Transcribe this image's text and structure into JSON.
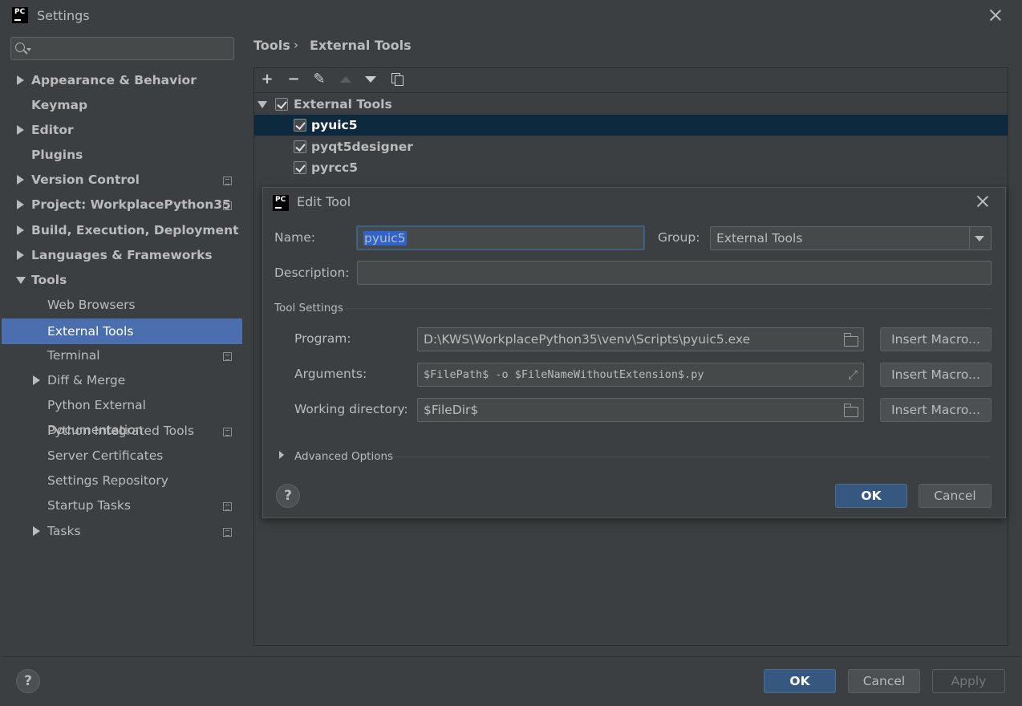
{
  "window": {
    "title": "Settings"
  },
  "search": {
    "placeholder": ""
  },
  "sidebar": {
    "items": [
      {
        "label": "Appearance & Behavior"
      },
      {
        "label": "Keymap"
      },
      {
        "label": "Editor"
      },
      {
        "label": "Plugins"
      },
      {
        "label": "Version Control"
      },
      {
        "label": "Project: WorkplacePython35"
      },
      {
        "label": "Build, Execution, Deployment"
      },
      {
        "label": "Languages & Frameworks"
      },
      {
        "label": "Tools"
      },
      {
        "label": "Web Browsers"
      },
      {
        "label": "External Tools"
      },
      {
        "label": "Terminal"
      },
      {
        "label": "Diff & Merge"
      },
      {
        "label": "Python External Documentation"
      },
      {
        "label": "Python Integrated Tools"
      },
      {
        "label": "Server Certificates"
      },
      {
        "label": "Settings Repository"
      },
      {
        "label": "Startup Tasks"
      },
      {
        "label": "Tasks"
      }
    ]
  },
  "breadcrumb": {
    "parent": "Tools",
    "separator": "›",
    "current": "External Tools"
  },
  "tree": {
    "group": "External Tools",
    "items": [
      {
        "label": "pyuic5"
      },
      {
        "label": "pyqt5designer"
      },
      {
        "label": "pyrcc5"
      }
    ]
  },
  "dialog": {
    "title": "Edit Tool",
    "name_label": "Name:",
    "name_value": "pyuic5",
    "group_label": "Group:",
    "group_value": "External Tools",
    "description_label": "Description:",
    "description_value": "",
    "tool_settings_label": "Tool Settings",
    "program_label": "Program:",
    "program_value": "D:\\KWS\\WorkplacePython35\\venv\\Scripts\\pyuic5.exe",
    "arguments_label": "Arguments:",
    "arguments_value": "$FilePath$ -o $FileNameWithoutExtension$.py",
    "workdir_label": "Working directory:",
    "workdir_value": "$FileDir$",
    "insert_macro_label": "Insert Macro...",
    "advanced_label": "Advanced Options",
    "help_label": "?",
    "ok_label": "OK",
    "cancel_label": "Cancel"
  },
  "footer": {
    "help_label": "?",
    "ok_label": "OK",
    "cancel_label": "Cancel",
    "apply_label": "Apply"
  },
  "colors": {
    "selection": "#4b6eaf",
    "tree_selection": "#0d293e",
    "primary_button": "#365880",
    "background": "#3c3f41"
  }
}
